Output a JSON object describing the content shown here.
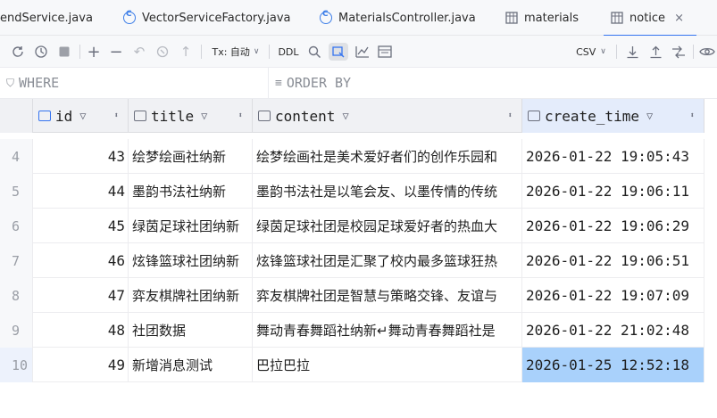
{
  "tabs": [
    {
      "label": "endService.java",
      "icon": "java-class-icon",
      "active": false
    },
    {
      "label": "VectorServiceFactory.java",
      "icon": "java-class-icon",
      "active": false
    },
    {
      "label": "MaterialsController.java",
      "icon": "java-class-icon",
      "active": false
    },
    {
      "label": "materials",
      "icon": "table-icon",
      "active": false
    },
    {
      "label": "notice",
      "icon": "table-icon",
      "active": true,
      "close": "×"
    }
  ],
  "toolbar": {
    "tx_label": "Tx: 自动",
    "ddl_label": "DDL",
    "format_label": "CSV"
  },
  "filters": {
    "where_label": "WHERE",
    "orderby_label": "ORDER BY"
  },
  "columns": [
    {
      "name": "id"
    },
    {
      "name": "title"
    },
    {
      "name": "content"
    },
    {
      "name": "create_time"
    }
  ],
  "rows": [
    {
      "num": "4",
      "id": "43",
      "title": "绘梦绘画社纳新",
      "content": "绘梦绘画社是美术爱好者们的创作乐园和",
      "create_time": "2026-01-22 19:05:43"
    },
    {
      "num": "5",
      "id": "44",
      "title": "墨韵书法社纳新",
      "content": "墨韵书法社是以笔会友、以墨传情的传统",
      "create_time": "2026-01-22 19:06:11"
    },
    {
      "num": "6",
      "id": "45",
      "title": "绿茵足球社团纳新",
      "content": "绿茵足球社团是校园足球爱好者的热血大",
      "create_time": "2026-01-22 19:06:29"
    },
    {
      "num": "7",
      "id": "46",
      "title": "炫锋篮球社团纳新",
      "content": "炫锋篮球社团是汇聚了校内最多篮球狂热",
      "create_time": "2026-01-22 19:06:51"
    },
    {
      "num": "8",
      "id": "47",
      "title": "弈友棋牌社团纳新",
      "content": "弈友棋牌社团是智慧与策略交锋、友谊与",
      "create_time": "2026-01-22 19:07:09"
    },
    {
      "num": "9",
      "id": "48",
      "title": "社团数据",
      "content": "舞动青春舞蹈社纳新↵舞动青春舞蹈社是",
      "create_time": "2026-01-22 21:02:48"
    },
    {
      "num": "10",
      "id": "49",
      "title": "新增消息测试",
      "content": "巴拉巴拉",
      "create_time": "2026-01-25 12:52:18"
    }
  ],
  "colors": {
    "accent": "#3574f0",
    "selected_cell": "#a9d1fb"
  }
}
